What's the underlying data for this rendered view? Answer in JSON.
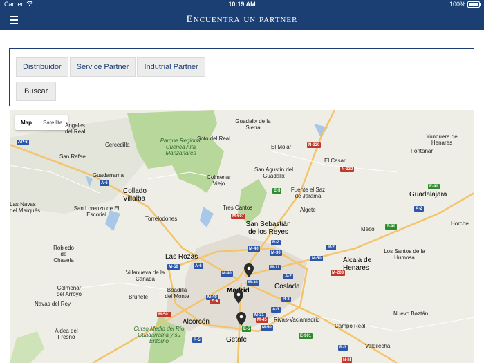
{
  "statusbar": {
    "carrier": "Carrier",
    "time": "10:19 AM",
    "battery": "100%"
  },
  "header": {
    "title": "Encuentra un partner"
  },
  "filters": {
    "tabs": [
      "Distribuidor",
      "Service Partner",
      "Indutrial Partner"
    ],
    "search_label": "Buscar"
  },
  "map": {
    "type_toggle": {
      "map_label": "Map",
      "satellite_label": "Satellite",
      "active": "Map"
    },
    "places": [
      {
        "name": "Ángeles"
      },
      {
        "name": "del Real"
      },
      {
        "name": "Guadalix de la Sierra"
      },
      {
        "name": "Cercedilla"
      },
      {
        "name": "Soto del Real"
      },
      {
        "name": "El Molar"
      },
      {
        "name": "Yunquera de Henares"
      },
      {
        "name": "Fontanar"
      },
      {
        "name": "San Rafael"
      },
      {
        "name": "El Casar"
      },
      {
        "name": "Guadarrama"
      },
      {
        "name": "San Agustín del Guadalix"
      },
      {
        "name": "Collado Villalba"
      },
      {
        "name": "Colmenar Viejo"
      },
      {
        "name": "Fuente el Saz de Jarama"
      },
      {
        "name": "Guadalajara"
      },
      {
        "name": "Las Navas del Marqués"
      },
      {
        "name": "San Lorenzo de El Escorial"
      },
      {
        "name": "Tres Cantos"
      },
      {
        "name": "Algete"
      },
      {
        "name": "Torrelodones"
      },
      {
        "name": "San Sebastián de los Reyes"
      },
      {
        "name": "Meco"
      },
      {
        "name": "Horche"
      },
      {
        "name": "Robledo de Chavela"
      },
      {
        "name": "Las Rozas"
      },
      {
        "name": "Los Santos de la Humosa"
      },
      {
        "name": "Alcalá de Henares"
      },
      {
        "name": "Villanueva de la Cañada"
      },
      {
        "name": "Coslada"
      },
      {
        "name": "Madrid"
      },
      {
        "name": "Colmenar del Arroyo"
      },
      {
        "name": "Boadilla del Monte"
      },
      {
        "name": "Brunete"
      },
      {
        "name": "Navas del Rey"
      },
      {
        "name": "Alcorcón"
      },
      {
        "name": "Rivas-Vaciamadrid"
      },
      {
        "name": "Nuevo Baztán"
      },
      {
        "name": "Campo Real"
      },
      {
        "name": "Aldea del Fresno"
      },
      {
        "name": "Getafe"
      },
      {
        "name": "Valdilecha"
      }
    ],
    "parks": [
      {
        "name": "Parque Regional Cuenca Alta Manzanares"
      },
      {
        "name": "Curso Medio del Río Guadarrama y su Entorno"
      }
    ],
    "roads": [
      "AP-6",
      "A-6",
      "N-320",
      "N-320",
      "E-5",
      "E-90",
      "M-607",
      "R-2",
      "M-40",
      "M-30",
      "M-11",
      "A-2",
      "A-6",
      "M-50",
      "M-50",
      "M-30",
      "M-40",
      "R-3",
      "M-40",
      "A-3",
      "M-501",
      "A-5",
      "M-31",
      "M-45",
      "E-5",
      "R-5",
      "M-50",
      "M-203",
      "E-901",
      "R-3",
      "N-III",
      "E-90",
      "R-2",
      "A-2"
    ],
    "pins": 3
  },
  "colors": {
    "brand": "#1b3f73",
    "park": "#b8d79a",
    "water": "#a9c8e8"
  }
}
